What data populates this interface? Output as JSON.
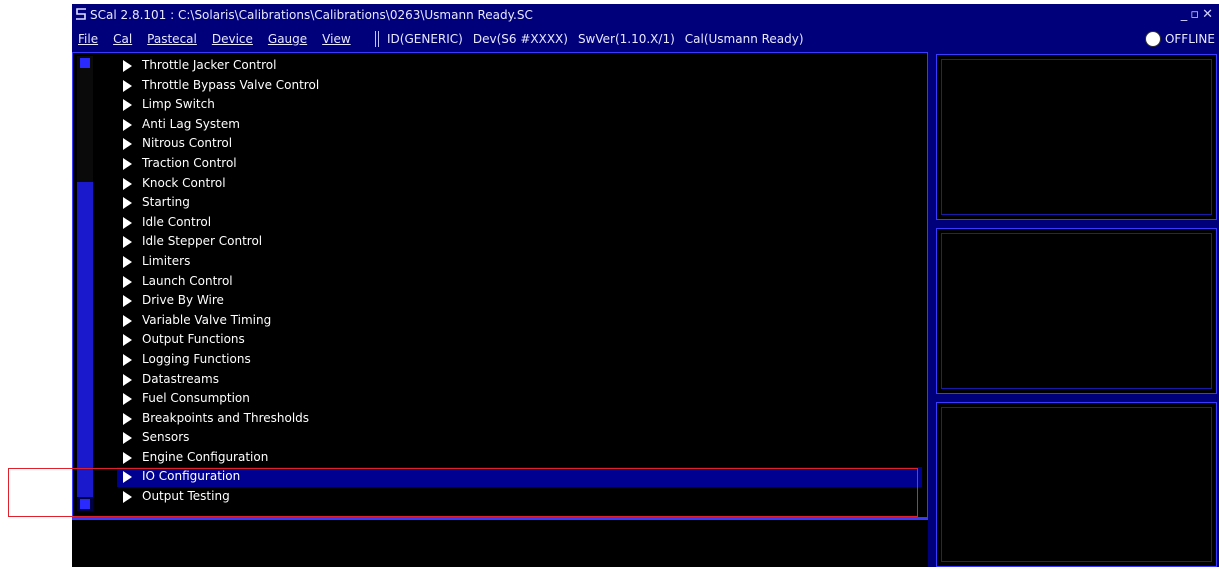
{
  "window": {
    "title": "SCal 2.8.101  :  C:\\Solaris\\Calibrations\\Calibrations\\0263\\Usmann Ready.SC",
    "controls": [
      "_",
      "▫",
      "✕"
    ]
  },
  "menubar": {
    "items": [
      "File",
      "Cal",
      "Pastecal",
      "Device",
      "Gauge",
      "View"
    ],
    "info": {
      "id": "ID(GENERIC)",
      "dev": "Dev(S6 #XXXX)",
      "swver": "SwVer(1.10.X/1)",
      "cal": "Cal(Usmann Ready)"
    },
    "status": "OFFLINE"
  },
  "tree": {
    "items": [
      "Throttle Jacker Control",
      "Throttle Bypass Valve Control",
      "Limp Switch",
      "Anti Lag System",
      "Nitrous Control",
      "Traction Control",
      "Knock Control",
      "Starting",
      "Idle Control",
      "Idle Stepper Control",
      "Limiters",
      "Launch Control",
      "Drive By Wire",
      "Variable Valve Timing",
      "Output Functions",
      "Logging Functions",
      "Datastreams",
      "Fuel Consumption",
      "Breakpoints and Thresholds",
      "Sensors",
      "Engine Configuration",
      "IO Configuration",
      "Output Testing"
    ],
    "selected": "IO Configuration"
  },
  "colors": {
    "app_background": "#00007a",
    "panel_background": "#000000",
    "selection": "#000090",
    "panel_border": "#3a3aff",
    "annotation": "#e0202a"
  }
}
